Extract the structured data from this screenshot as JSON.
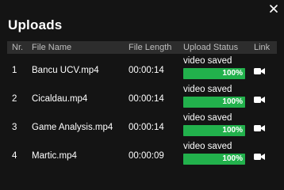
{
  "dialog": {
    "title": "Uploads",
    "close_icon": "close-icon"
  },
  "table": {
    "columns": [
      "Nr.",
      "File Name",
      "File Length",
      "Upload Status",
      "Link"
    ],
    "rows": [
      {
        "nr": "1",
        "file_name": "Bancu UCV.mp4",
        "length": "00:00:14",
        "status": "video saved",
        "progress": 100,
        "progress_label": "100%",
        "link_icon": "video-camera-icon"
      },
      {
        "nr": "2",
        "file_name": "Cicaldau.mp4",
        "length": "00:00:14",
        "status": "video saved",
        "progress": 100,
        "progress_label": "100%",
        "link_icon": "video-camera-icon"
      },
      {
        "nr": "3",
        "file_name": "Game Analysis.mp4",
        "length": "00:00:14",
        "status": "video saved",
        "progress": 100,
        "progress_label": "100%",
        "link_icon": "video-camera-icon"
      },
      {
        "nr": "4",
        "file_name": "Martic.mp4",
        "length": "00:00:09",
        "status": "video saved",
        "progress": 100,
        "progress_label": "100%",
        "link_icon": "video-camera-icon"
      }
    ]
  },
  "colors": {
    "background": "#141414",
    "header_bar": "#2d2d2d",
    "progress_green": "#22b14c"
  }
}
